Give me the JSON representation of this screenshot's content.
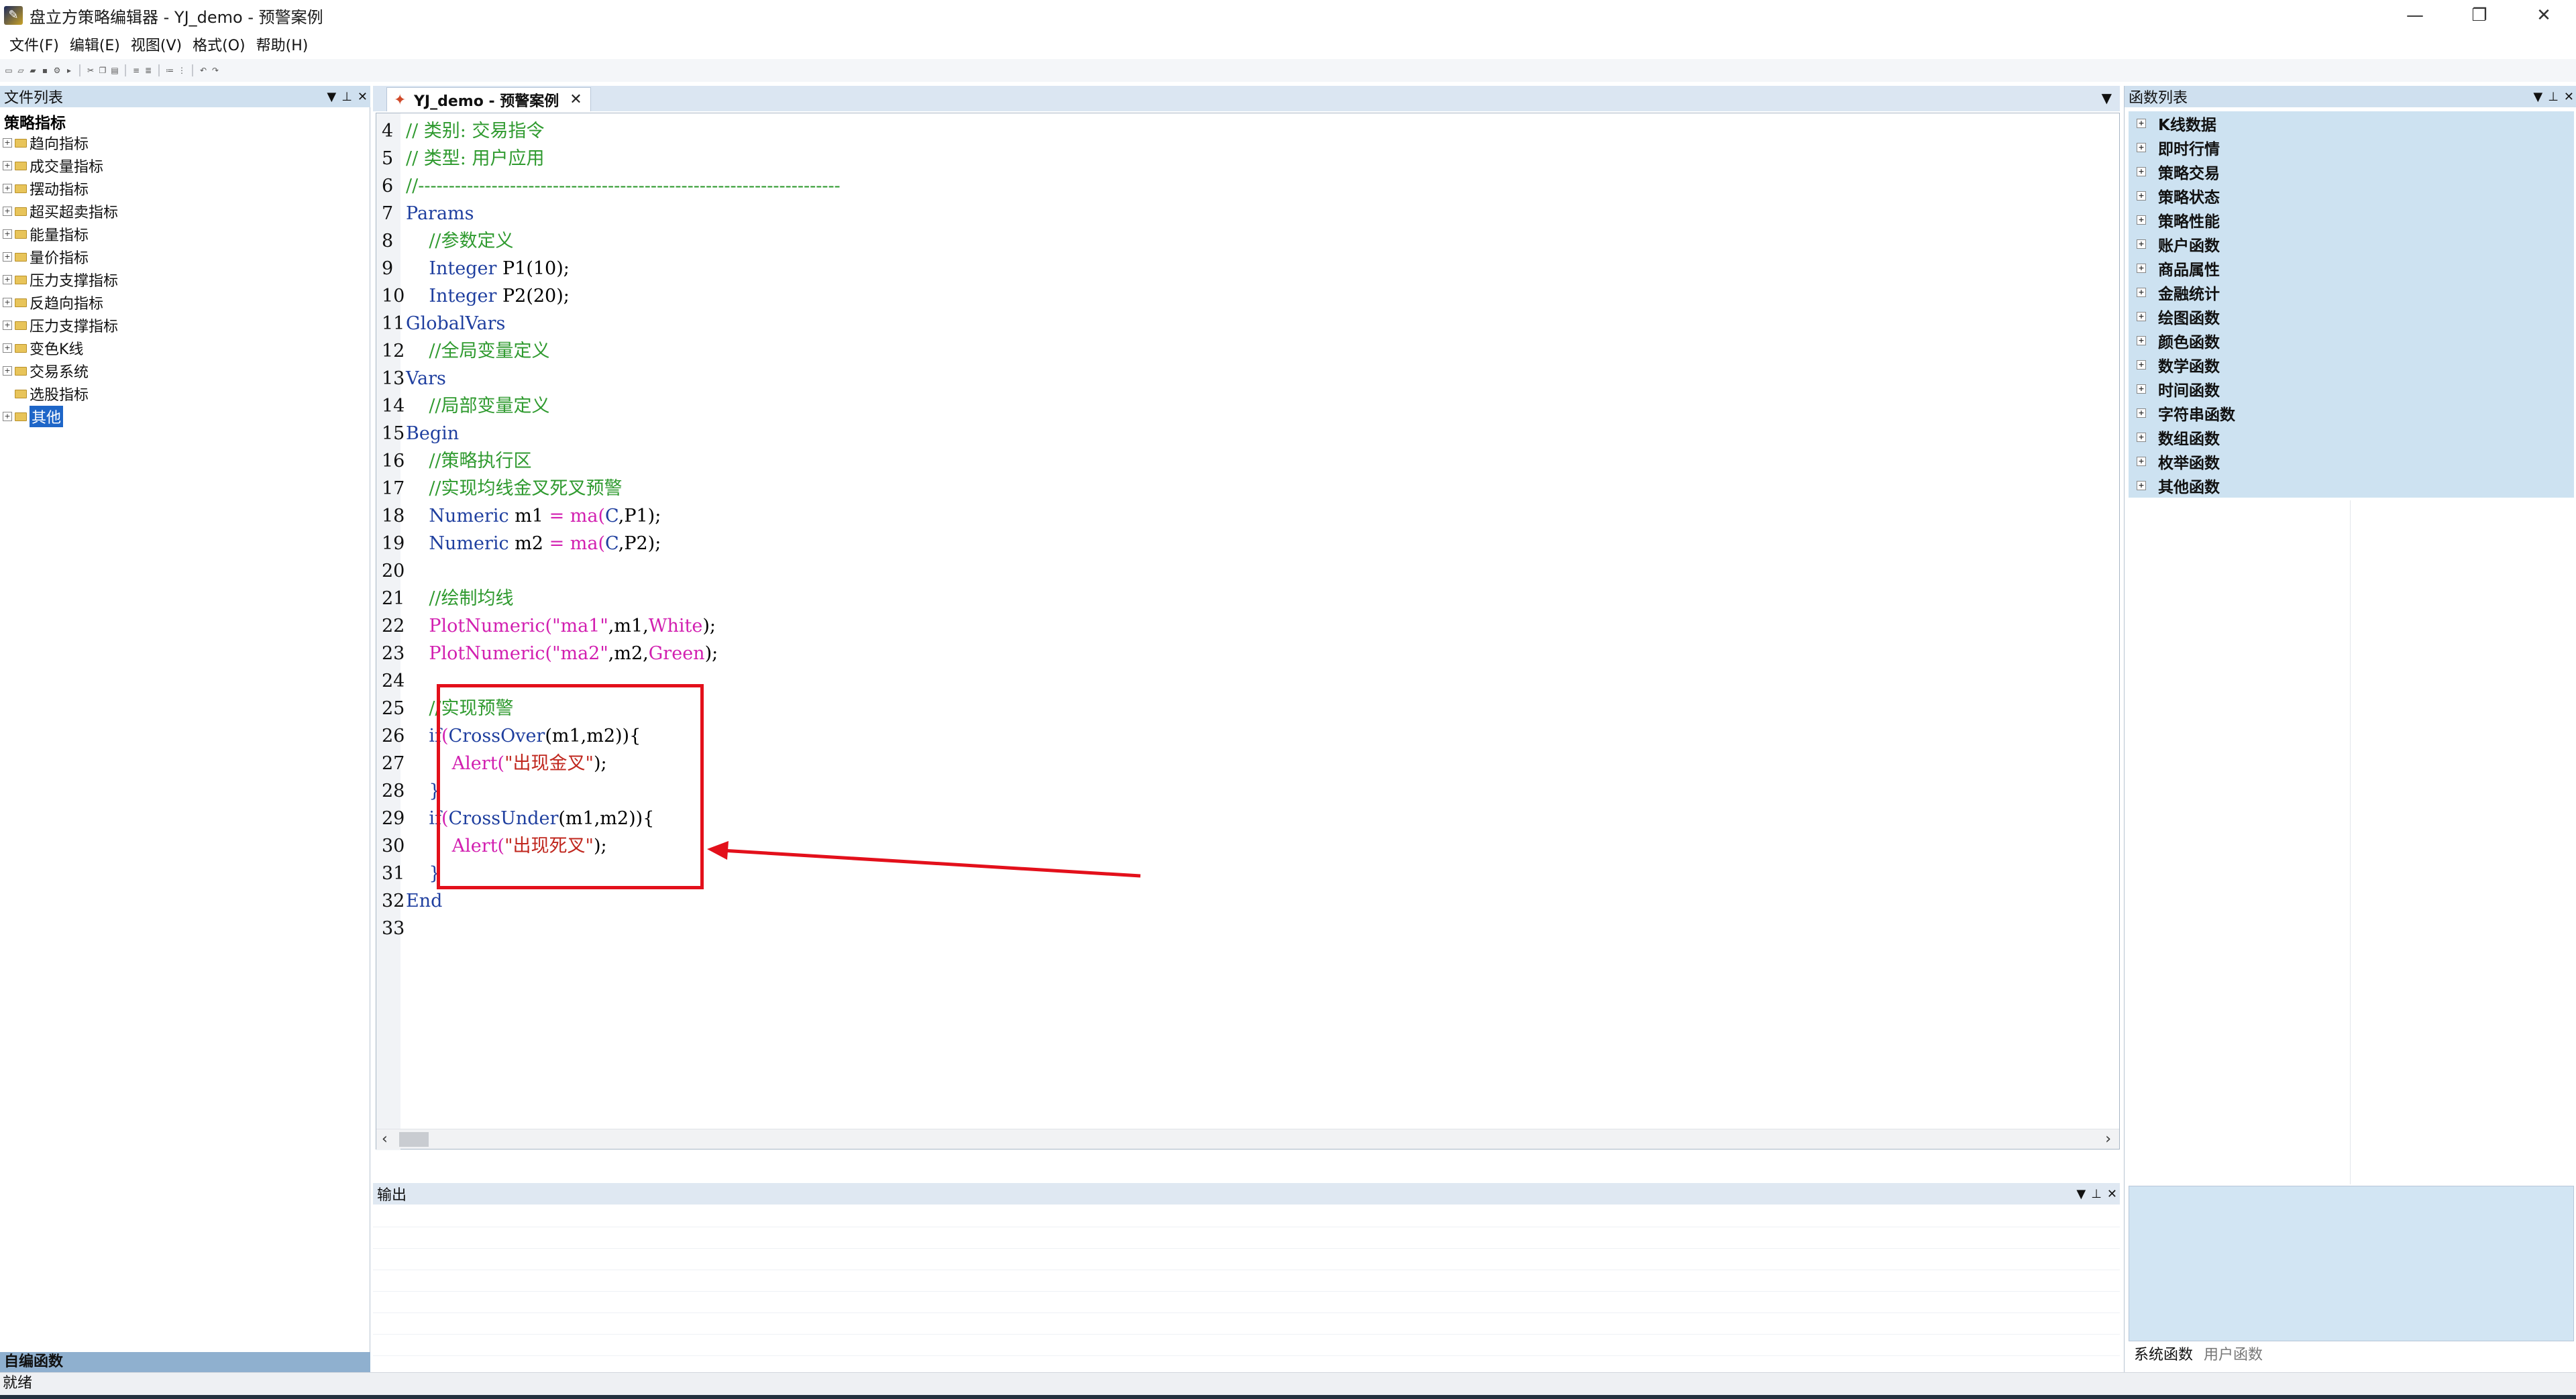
{
  "window": {
    "title": "盘立方策略编辑器 - YJ_demo - 预警案例",
    "controls": [
      "—",
      "❐",
      "✕"
    ]
  },
  "menu": [
    "文件(F)",
    "编辑(E)",
    "视图(V)",
    "格式(O)",
    "帮助(H)"
  ],
  "left_panel": {
    "title": "文件列表",
    "root": "策略指标",
    "items": [
      {
        "label": "趋向指标",
        "expandable": true,
        "selected": false
      },
      {
        "label": "成交量指标",
        "expandable": true,
        "selected": false
      },
      {
        "label": "摆动指标",
        "expandable": true,
        "selected": false
      },
      {
        "label": "超买超卖指标",
        "expandable": true,
        "selected": false
      },
      {
        "label": "能量指标",
        "expandable": true,
        "selected": false
      },
      {
        "label": "量价指标",
        "expandable": true,
        "selected": false
      },
      {
        "label": "压力支撑指标",
        "expandable": true,
        "selected": false
      },
      {
        "label": "反趋向指标",
        "expandable": true,
        "selected": false
      },
      {
        "label": "压力支撑指标",
        "expandable": true,
        "selected": false
      },
      {
        "label": "变色K线",
        "expandable": true,
        "selected": false
      },
      {
        "label": "交易系统",
        "expandable": true,
        "selected": false
      },
      {
        "label": "选股指标",
        "expandable": false,
        "selected": false
      },
      {
        "label": "其他",
        "expandable": true,
        "selected": true
      }
    ],
    "footer": "自编函数"
  },
  "editor": {
    "tab_label": "YJ_demo - 预警案例",
    "lines": [
      {
        "n": "4",
        "tokens": [
          {
            "t": "// 类别: 交易指令",
            "c": "cm"
          }
        ]
      },
      {
        "n": "5",
        "tokens": [
          {
            "t": "// 类型: 用户应用",
            "c": "cm"
          }
        ]
      },
      {
        "n": "6",
        "tokens": [
          {
            "t": "//---------------------------------------------------------------------",
            "c": "cm"
          }
        ]
      },
      {
        "n": "7",
        "tokens": [
          {
            "t": "Params",
            "c": "kw"
          }
        ]
      },
      {
        "n": "8",
        "tokens": [
          {
            "t": "    //参数定义",
            "c": "cm"
          }
        ]
      },
      {
        "n": "9",
        "tokens": [
          {
            "t": "    ",
            "c": ""
          },
          {
            "t": "Integer",
            "c": "kw"
          },
          {
            "t": " P1(10);",
            "c": ""
          }
        ]
      },
      {
        "n": "10",
        "tokens": [
          {
            "t": "    ",
            "c": ""
          },
          {
            "t": "Integer",
            "c": "kw"
          },
          {
            "t": " P2(20);",
            "c": ""
          }
        ]
      },
      {
        "n": "11",
        "tokens": [
          {
            "t": "GlobalVars",
            "c": "kw"
          }
        ]
      },
      {
        "n": "12",
        "tokens": [
          {
            "t": "    //全局变量定义",
            "c": "cm"
          }
        ]
      },
      {
        "n": "13",
        "tokens": [
          {
            "t": "Vars",
            "c": "kw"
          }
        ]
      },
      {
        "n": "14",
        "tokens": [
          {
            "t": "    //局部变量定义",
            "c": "cm"
          }
        ]
      },
      {
        "n": "15",
        "tokens": [
          {
            "t": "Begin",
            "c": "kw"
          }
        ]
      },
      {
        "n": "16",
        "tokens": [
          {
            "t": "    //策略执行区",
            "c": "cm"
          }
        ]
      },
      {
        "n": "17",
        "tokens": [
          {
            "t": "    //实现均线金叉死叉预警",
            "c": "cm"
          }
        ]
      },
      {
        "n": "18",
        "tokens": [
          {
            "t": "    ",
            "c": ""
          },
          {
            "t": "Numeric",
            "c": "kw"
          },
          {
            "t": " m1 ",
            "c": ""
          },
          {
            "t": "=",
            "c": "fn"
          },
          {
            "t": " ",
            "c": ""
          },
          {
            "t": "ma",
            "c": "fn"
          },
          {
            "t": "(",
            "c": "fn"
          },
          {
            "t": "C",
            "c": "kw"
          },
          {
            "t": ",P1);",
            "c": ""
          }
        ]
      },
      {
        "n": "19",
        "tokens": [
          {
            "t": "    ",
            "c": ""
          },
          {
            "t": "Numeric",
            "c": "kw"
          },
          {
            "t": " m2 ",
            "c": ""
          },
          {
            "t": "=",
            "c": "fn"
          },
          {
            "t": " ",
            "c": ""
          },
          {
            "t": "ma",
            "c": "fn"
          },
          {
            "t": "(",
            "c": "fn"
          },
          {
            "t": "C",
            "c": "kw"
          },
          {
            "t": ",P2);",
            "c": ""
          }
        ]
      },
      {
        "n": "20",
        "tokens": []
      },
      {
        "n": "21",
        "tokens": [
          {
            "t": "    //绘制均线",
            "c": "cm"
          }
        ]
      },
      {
        "n": "22",
        "tokens": [
          {
            "t": "    ",
            "c": ""
          },
          {
            "t": "PlotNumeric",
            "c": "fn"
          },
          {
            "t": "(",
            "c": "fn"
          },
          {
            "t": "\"ma1\"",
            "c": "fn"
          },
          {
            "t": ",m1,",
            "c": ""
          },
          {
            "t": "White",
            "c": "fn"
          },
          {
            "t": ");",
            "c": ""
          }
        ]
      },
      {
        "n": "23",
        "tokens": [
          {
            "t": "    ",
            "c": ""
          },
          {
            "t": "PlotNumeric",
            "c": "fn"
          },
          {
            "t": "(",
            "c": "fn"
          },
          {
            "t": "\"ma2\"",
            "c": "fn"
          },
          {
            "t": ",m2,",
            "c": ""
          },
          {
            "t": "Green",
            "c": "fn"
          },
          {
            "t": ");",
            "c": ""
          }
        ]
      },
      {
        "n": "24",
        "tokens": []
      },
      {
        "n": "25",
        "tokens": [
          {
            "t": "    //实现预警",
            "c": "cm"
          }
        ]
      },
      {
        "n": "26",
        "tokens": [
          {
            "t": "    ",
            "c": ""
          },
          {
            "t": "if",
            "c": "kw"
          },
          {
            "t": "(",
            "c": "fn"
          },
          {
            "t": "CrossOver",
            "c": "kw"
          },
          {
            "t": "(m1,m2)){",
            "c": ""
          }
        ]
      },
      {
        "n": "27",
        "tokens": [
          {
            "t": "        ",
            "c": ""
          },
          {
            "t": "Alert",
            "c": "fn"
          },
          {
            "t": "(",
            "c": "fn"
          },
          {
            "t": "\"出现金叉\"",
            "c": "str"
          },
          {
            "t": ");",
            "c": ""
          }
        ]
      },
      {
        "n": "28",
        "tokens": [
          {
            "t": "    }",
            "c": "kw"
          }
        ]
      },
      {
        "n": "29",
        "tokens": [
          {
            "t": "    ",
            "c": ""
          },
          {
            "t": "if",
            "c": "kw"
          },
          {
            "t": "(",
            "c": "fn"
          },
          {
            "t": "CrossUnder",
            "c": "kw"
          },
          {
            "t": "(m1,m2)){",
            "c": ""
          }
        ]
      },
      {
        "n": "30",
        "tokens": [
          {
            "t": "        ",
            "c": ""
          },
          {
            "t": "Alert",
            "c": "fn"
          },
          {
            "t": "(",
            "c": "fn"
          },
          {
            "t": "\"出现死叉\"",
            "c": "str"
          },
          {
            "t": ");",
            "c": ""
          }
        ]
      },
      {
        "n": "31",
        "tokens": [
          {
            "t": "    }",
            "c": "kw"
          }
        ]
      },
      {
        "n": "32",
        "tokens": [
          {
            "t": "End",
            "c": "kw"
          }
        ]
      },
      {
        "n": "33",
        "tokens": []
      }
    ]
  },
  "output_panel": {
    "title": "输出"
  },
  "right_panel": {
    "title": "函数列表",
    "items": [
      "K线数据",
      "即时行情",
      "策略交易",
      "策略状态",
      "策略性能",
      "账户函数",
      "商品属性",
      "金融统计",
      "绘图函数",
      "颜色函数",
      "数学函数",
      "时间函数",
      "字符串函数",
      "数组函数",
      "枚举函数",
      "其他函数"
    ],
    "tabs": [
      "系统函数",
      "用户函数"
    ]
  },
  "status": "就绪",
  "colors": {
    "highlight": "#e3101b",
    "arrow": "#e3101b",
    "comment": "#2f9a2f",
    "keyword": "#1f3f9f",
    "function": "#d21fb0",
    "string": "#c0271e",
    "selected": "#1e66c8"
  }
}
